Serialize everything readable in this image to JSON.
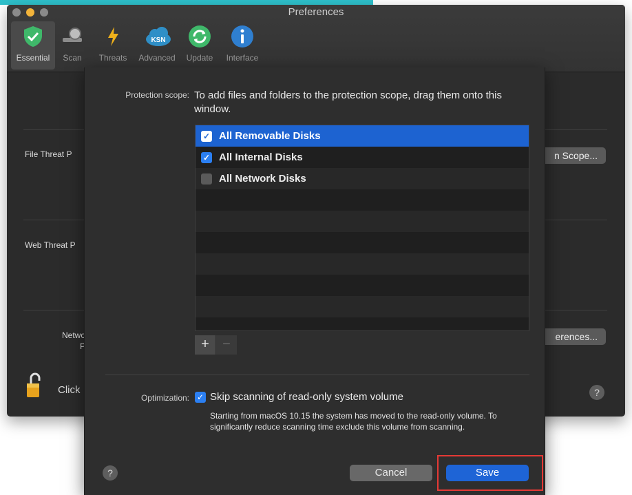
{
  "window": {
    "title": "Preferences",
    "traffic_colors": [
      "#8a8a8a",
      "#f2b33a",
      "#8a8a8a"
    ]
  },
  "toolbar": {
    "items": [
      {
        "label": "Essential",
        "icon": "shield-check-icon",
        "active": true
      },
      {
        "label": "Scan",
        "icon": "scan-magnifier-icon"
      },
      {
        "label": "Threats",
        "icon": "lightning-bolt-icon"
      },
      {
        "label": "Advanced",
        "icon": "ksn-cloud-icon",
        "icon_text": "KSN"
      },
      {
        "label": "Update",
        "icon": "refresh-icon"
      },
      {
        "label": "Interface",
        "icon": "info-icon"
      }
    ]
  },
  "background": {
    "file_threat_label": "File Threat P",
    "web_threat_label": "Web Threat P",
    "network_label_line1": "Netwo",
    "network_label_line2": "P",
    "scope_button_label": "n Scope...",
    "preferences_button_label": "erences...",
    "lock_text": "Click",
    "help": "?"
  },
  "sheet": {
    "protection_scope_label": "Protection scope:",
    "protection_scope_desc": "To add files and folders to the protection scope, drag them onto this window.",
    "disks": [
      {
        "label": "All Removable Disks",
        "checked": true,
        "selected": true
      },
      {
        "label": "All Internal Disks",
        "checked": true
      },
      {
        "label": "All Network Disks",
        "checked": false
      }
    ],
    "add_label": "+",
    "remove_label": "−",
    "optimization_label": "Optimization:",
    "optimization_option": "Skip scanning of read-only system volume",
    "optimization_note": "Starting from macOS 10.15 the system has moved to the read-only volume. To significantly reduce scanning time exclude this volume from scanning.",
    "help": "?",
    "cancel_label": "Cancel",
    "save_label": "Save"
  },
  "colors": {
    "accent_blue": "#1e64d6",
    "highlight_red": "#e53935",
    "top_strip": "#2fc1cc"
  }
}
